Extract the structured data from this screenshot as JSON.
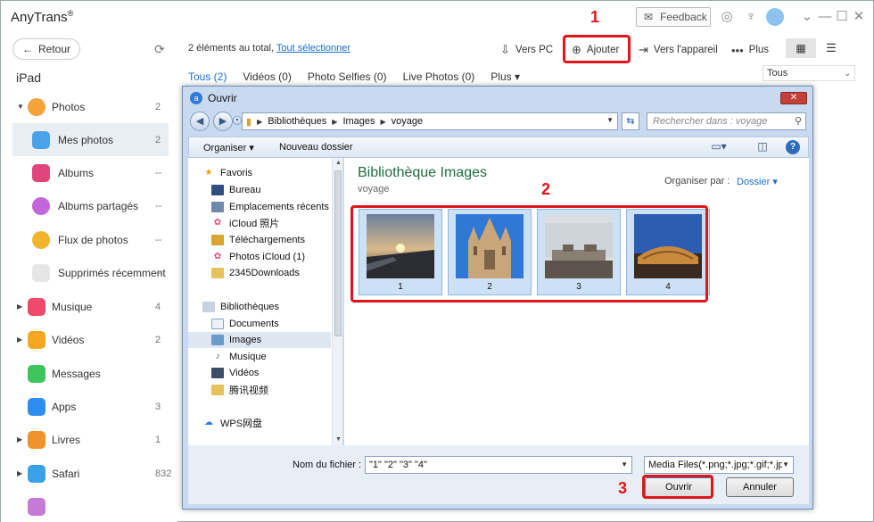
{
  "app": {
    "title": "AnyTrans",
    "title_mark": "®",
    "feedback_label": "Feedback"
  },
  "sidebar": {
    "back_label": "Retour",
    "device_name": "iPad",
    "items": [
      {
        "label": "Photos",
        "count": "2",
        "arrow": "▼",
        "icon_color": "#f2a33a"
      },
      {
        "label": "Mes photos",
        "count": "2",
        "icon_color": "#4aa3e8"
      },
      {
        "label": "Albums",
        "count": "--",
        "icon_color": "#e0457b"
      },
      {
        "label": "Albums partagés",
        "count": "--",
        "icon_color": "#c266d9"
      },
      {
        "label": "Flux de photos",
        "count": "--",
        "icon_color": "#f0b52d"
      },
      {
        "label": "Supprimés récemment",
        "count": "--",
        "icon_color": "#9a9a9a"
      },
      {
        "label": "Musique",
        "count": "4",
        "arrow": "▶",
        "icon_color": "#f04a6a"
      },
      {
        "label": "Vidéos",
        "count": "2",
        "arrow": "▶",
        "icon_color": "#f5a623"
      },
      {
        "label": "Messages",
        "count": "",
        "icon_color": "#3ec45a"
      },
      {
        "label": "Apps",
        "count": "3",
        "icon_color": "#2d8ef0"
      },
      {
        "label": "Livres",
        "count": "1",
        "arrow": "▶",
        "icon_color": "#f2922c"
      },
      {
        "label": "Safari",
        "count": "832",
        "arrow": "▶",
        "icon_color": "#3aa0e8"
      }
    ]
  },
  "toolbar": {
    "total_text": "2 éléments au total,",
    "select_all": "Tout sélectionner",
    "to_pc": "Vers PC",
    "add": "Ajouter",
    "to_device": "Vers l'appareil",
    "more": "Plus"
  },
  "tabs": [
    "Tous (2)",
    "Vidéos (0)",
    "Photo Selfies (0)",
    "Live Photos (0)",
    "Plus ▾"
  ],
  "filter": {
    "value": "Tous"
  },
  "dialog": {
    "title": "Ouvrir",
    "path": [
      "Bibliothèques",
      "Images",
      "voyage"
    ],
    "search_placeholder": "Rechercher dans : voyage",
    "organize": "Organiser",
    "new_folder": "Nouveau dossier",
    "nav": {
      "favorites_header": "Favoris",
      "favorites": [
        "Bureau",
        "Emplacements récents",
        "iCloud 照片",
        "Téléchargements",
        "Photos iCloud (1)",
        "2345Downloads"
      ],
      "libraries_header": "Bibliothèques",
      "libraries": [
        "Documents",
        "Images",
        "Musique",
        "Vidéos",
        "腾讯视频"
      ],
      "wps": "WPS网盘"
    },
    "library_title": "Bibliothèque Images",
    "library_sub": "voyage",
    "arrange_label": "Organiser par :",
    "arrange_value": "Dossier",
    "thumbnails": [
      "1",
      "2",
      "3",
      "4"
    ],
    "filename_label": "Nom du fichier :",
    "filename_value": "\"1\" \"2\" \"3\" \"4\"",
    "filetype": "Media Files(*.png;*.jpg;*.gif;*.jp",
    "open_btn": "Ouvrir",
    "cancel_btn": "Annuler"
  },
  "annotations": {
    "n1": "1",
    "n2": "2",
    "n3": "3",
    "color": "#e0151b"
  }
}
